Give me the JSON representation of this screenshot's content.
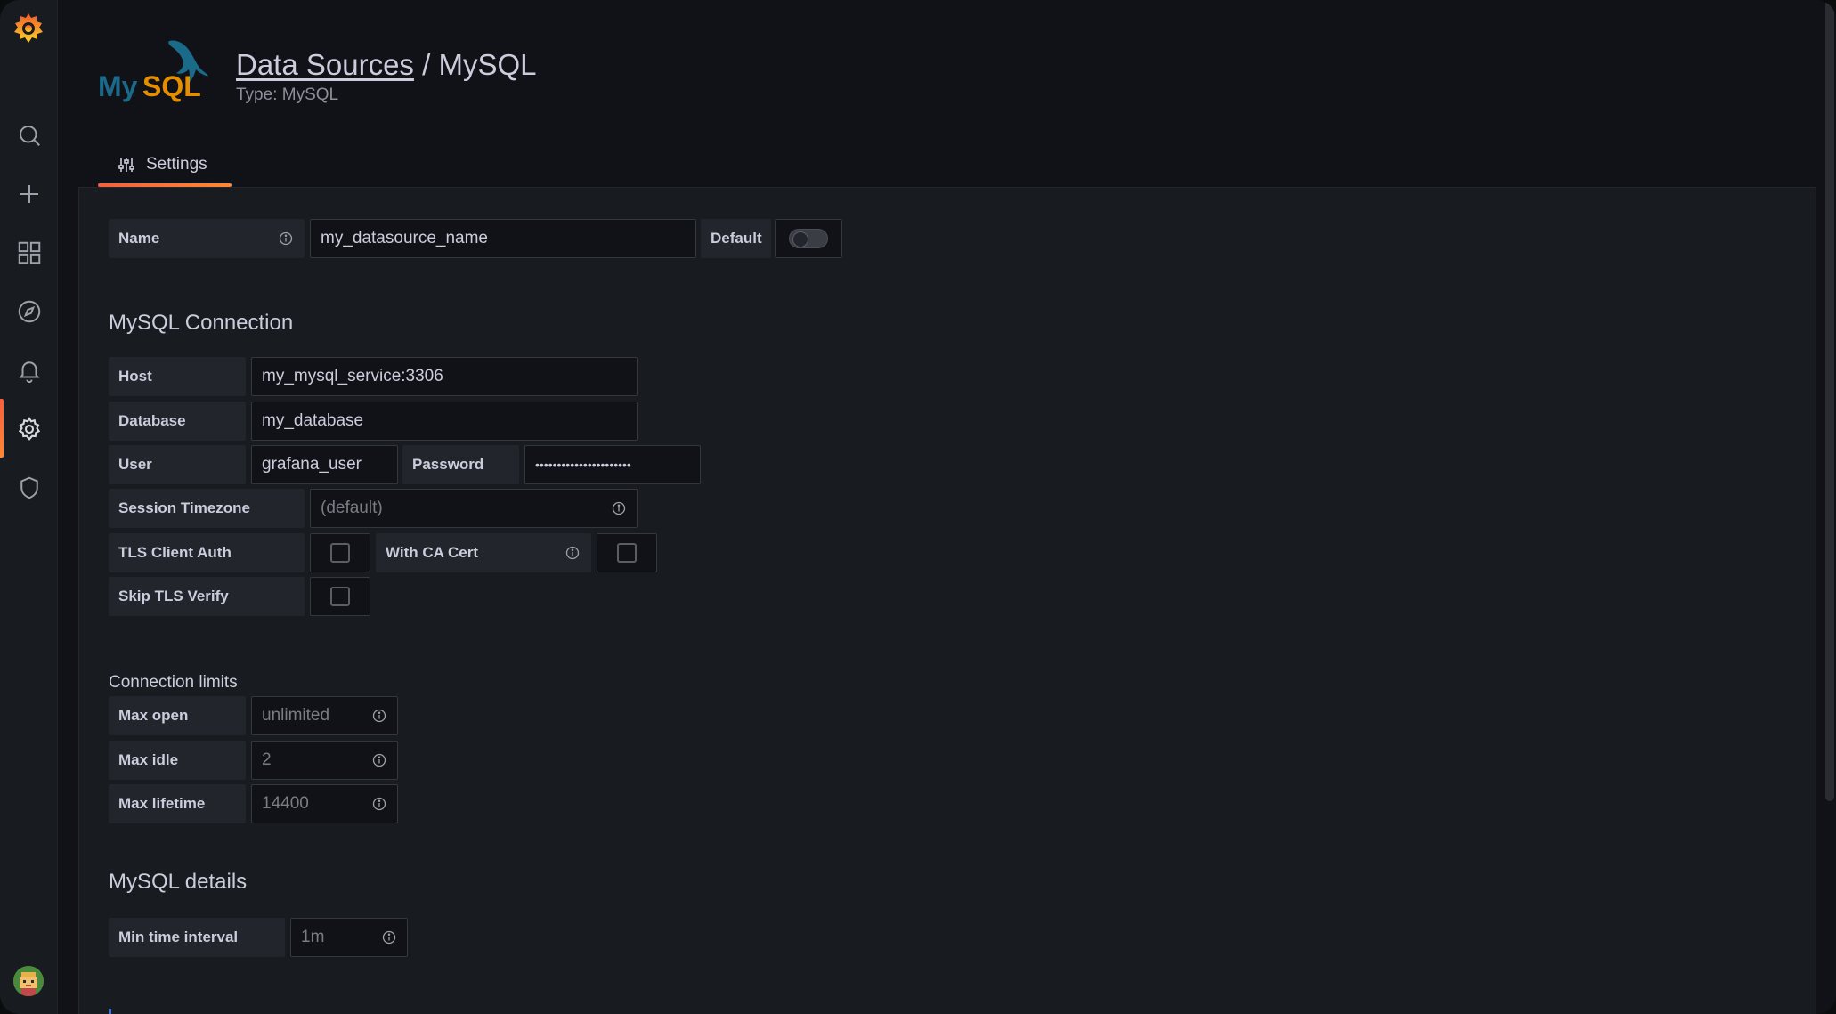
{
  "header": {
    "breadcrumb_link": "Data Sources",
    "breadcrumb_sep": " / ",
    "breadcrumb_current": "MySQL",
    "subtitle": "Type: MySQL"
  },
  "tabs": [
    {
      "label": "Settings"
    }
  ],
  "form": {
    "name_label": "Name",
    "name_value": "my_datasource_name",
    "default_label": "Default",
    "default_enabled": false
  },
  "connection": {
    "title": "MySQL Connection",
    "host_label": "Host",
    "host_value": "my_mysql_service:3306",
    "database_label": "Database",
    "database_value": "my_database",
    "user_label": "User",
    "user_value": "grafana_user",
    "password_label": "Password",
    "password_value": "••••••••••••••••••••••",
    "timezone_label": "Session Timezone",
    "timezone_placeholder": "(default)",
    "tls_client_auth_label": "TLS Client Auth",
    "with_ca_cert_label": "With CA Cert",
    "skip_tls_label": "Skip TLS Verify"
  },
  "limits": {
    "title": "Connection limits",
    "max_open_label": "Max open",
    "max_open_placeholder": "unlimited",
    "max_idle_label": "Max idle",
    "max_idle_placeholder": "2",
    "max_lifetime_label": "Max lifetime",
    "max_lifetime_placeholder": "14400"
  },
  "details": {
    "title": "MySQL details",
    "min_interval_label": "Min time interval",
    "min_interval_placeholder": "1m"
  },
  "sidemenu": {
    "icons": [
      "grafana-logo-icon",
      "search-icon",
      "plus-icon",
      "dashboards-icon",
      "explore-icon",
      "alerting-icon",
      "settings-gear-icon",
      "shield-icon"
    ],
    "active": "settings-gear-icon"
  },
  "colors": {
    "accent": "#ff8833",
    "background": "#111217",
    "panel": "#181b1f"
  }
}
